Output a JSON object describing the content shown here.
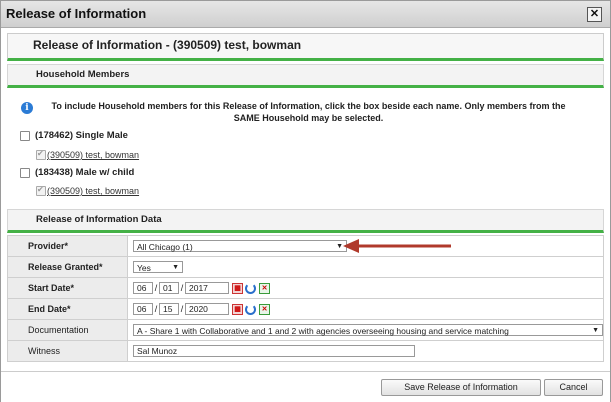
{
  "window": {
    "title": "Release of Information",
    "close_glyph": "✕"
  },
  "header": {
    "title": "Release of Information - (390509) test, bowman"
  },
  "household": {
    "section_title": "Household Members",
    "info_text": "To include Household members for this Release of Information, click the box beside each name. Only members from the SAME Household may be selected.",
    "groups": [
      {
        "label": "(178462) Single Male",
        "member": "(390509) test, bowman"
      },
      {
        "label": "(183438) Male w/ child",
        "member": "(390509) test, bowman"
      }
    ]
  },
  "roi": {
    "section_title": "Release of Information Data",
    "provider": {
      "label": "Provider",
      "required": "*",
      "value": "All Chicago (1)"
    },
    "granted": {
      "label": "Release Granted",
      "required": "*",
      "value": "Yes"
    },
    "start_date": {
      "label": "Start Date",
      "required": "*",
      "month": "06",
      "day": "01",
      "year": "2017"
    },
    "end_date": {
      "label": "End Date",
      "required": "*",
      "month": "06",
      "day": "15",
      "year": "2020"
    },
    "documentation": {
      "label": "Documentation",
      "value": "A - Share 1 with Collaborative and 1 and 2 with agencies overseeing housing and service matching"
    },
    "witness": {
      "label": "Witness",
      "value": "Sal Munoz"
    },
    "date_sep": "/"
  },
  "footer": {
    "save_label": "Save Release of Information",
    "cancel_label": "Cancel"
  },
  "colors": {
    "accent_green": "#44b146",
    "annotation_arrow": "#b0392b",
    "info_blue": "#2b7bd5"
  }
}
